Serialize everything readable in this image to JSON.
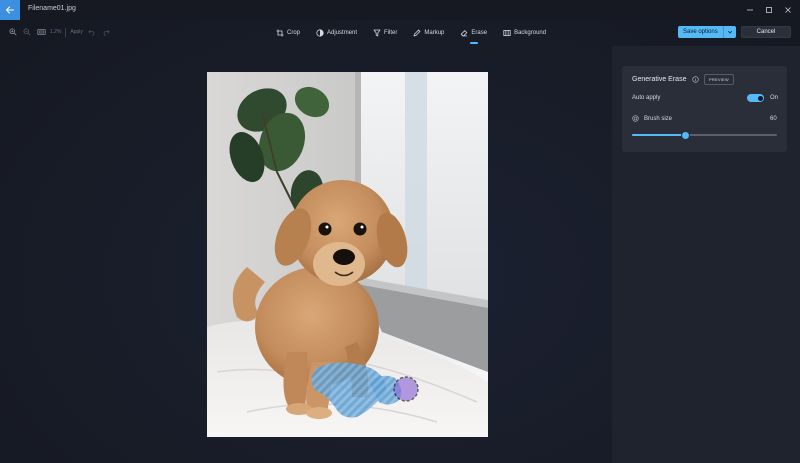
{
  "titlebar": {
    "filename": "Filename01.jpg"
  },
  "zoom": {
    "level": "1.2%",
    "apply_label": "Apply"
  },
  "tools": [
    {
      "label": "Crop",
      "icon": "crop-icon"
    },
    {
      "label": "Adjustment",
      "icon": "adjustment-icon"
    },
    {
      "label": "Filter",
      "icon": "filter-icon"
    },
    {
      "label": "Markup",
      "icon": "markup-icon"
    },
    {
      "label": "Erase",
      "icon": "erase-icon",
      "active": true
    },
    {
      "label": "Background",
      "icon": "background-icon"
    }
  ],
  "actions": {
    "save_label": "Save options",
    "cancel_label": "Cancel"
  },
  "panel": {
    "title": "Generative Erase",
    "badge": "PREVIEW",
    "auto_apply_label": "Auto apply",
    "auto_apply_state": "On",
    "brush_size_label": "Brush size",
    "brush_size_value": "60",
    "brush_size_fraction": 0.37
  },
  "colors": {
    "accent": "#55b9f5",
    "back_button": "#3d8fe0",
    "background": "#181c27"
  }
}
